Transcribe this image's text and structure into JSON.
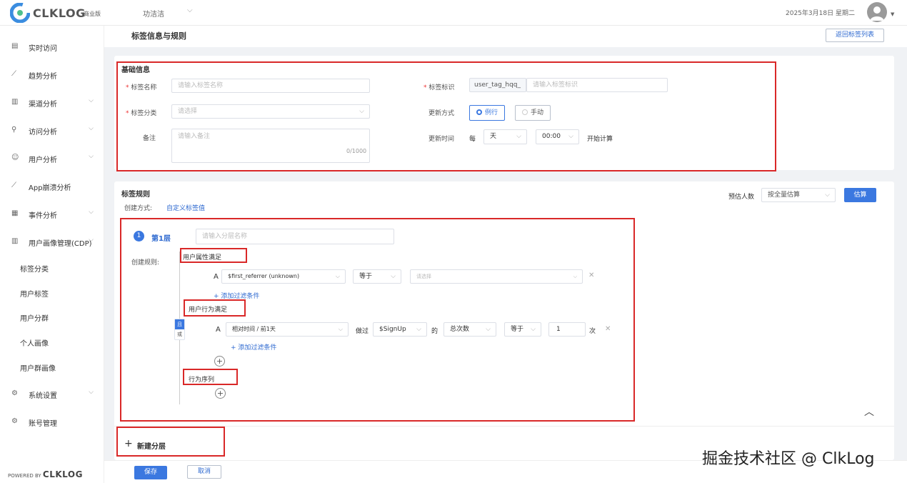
{
  "header": {
    "brand": "CLKLOG",
    "edition": "商业版",
    "project": "功洁洁",
    "date": "2025年3月18日 星期二"
  },
  "sidebar": {
    "items": [
      {
        "label": "实时访问",
        "icon": "realtime-icon",
        "has_chevron": false
      },
      {
        "label": "趋势分析",
        "icon": "trend-icon",
        "has_chevron": false
      },
      {
        "label": "渠道分析",
        "icon": "channel-icon",
        "has_chevron": true
      },
      {
        "label": "访问分析",
        "icon": "visit-icon",
        "has_chevron": true
      },
      {
        "label": "用户分析",
        "icon": "user-icon",
        "has_chevron": true
      },
      {
        "label": "App崩溃分析",
        "icon": "crash-icon",
        "has_chevron": false
      },
      {
        "label": "事件分析",
        "icon": "event-icon",
        "has_chevron": true
      },
      {
        "label": "用户画像管理(CDP)",
        "icon": "cdp-icon",
        "has_chevron": true
      }
    ],
    "sub_items": [
      "标签分类",
      "用户标签",
      "用户分群",
      "个人画像",
      "用户群画像"
    ],
    "bottom_items": [
      {
        "label": "系统设置",
        "icon": "gear-icon",
        "has_chevron": true
      },
      {
        "label": "账号管理",
        "icon": "account-icon",
        "has_chevron": false
      }
    ],
    "powered_by": "POWERED BY",
    "powered_brand": "CLKLOG"
  },
  "page": {
    "title": "标签信息与规则",
    "back_button": "返回标签列表"
  },
  "basic": {
    "section_title": "基础信息",
    "name_label": "标签名称",
    "name_placeholder": "请输入标签名称",
    "id_label": "标签标识",
    "id_prefix": "user_tag_hqq_",
    "id_placeholder": "请输入标签标识",
    "category_label": "标签分类",
    "category_placeholder": "请选择",
    "update_mode_label": "更新方式",
    "update_mode_options": [
      "例行",
      "手动"
    ],
    "note_label": "备注",
    "note_placeholder": "请输入备注",
    "note_counter": "0/1000",
    "update_time_label": "更新时间",
    "every": "每",
    "period": "天",
    "time": "00:00",
    "start_calc": "开始计算"
  },
  "rules": {
    "section_title": "标签规则",
    "create_mode_label": "创建方式:",
    "create_mode_value": "自定义标签值",
    "estimate_label": "预估人数",
    "estimate_select": "按全量估算",
    "estimate_button": "估算",
    "layer_number": "1",
    "layer_title": "第1层",
    "layer_placeholder": "请输入分层名称",
    "create_rule_label": "创建规则:",
    "user_attr_title": "用户属性满足",
    "attr_letter": "A",
    "attr_field": "$first_referrer (unknown)",
    "attr_op": "等于",
    "attr_value_placeholder": "请选择",
    "add_filter": "+ 添加过滤条件",
    "user_behavior_title": "用户行为满足",
    "and_label": "且",
    "or_label": "或",
    "beh_letter": "A",
    "beh_time": "相对时间 / 前1天",
    "beh_did": "做过",
    "beh_event": "$SignUp",
    "beh_of": "的",
    "beh_metric": "总次数",
    "beh_op": "等于",
    "beh_value": "1",
    "beh_unit": "次",
    "add_filter2": "+ 添加过滤条件",
    "sequence_title": "行为序列",
    "collapse_icon": "chevron-up-icon"
  },
  "new_layer": {
    "label": "新建分层"
  },
  "footer": {
    "save": "保存",
    "cancel": "取消"
  },
  "watermark": "掘金技术社区 @ ClkLog",
  "colors": {
    "primary": "#3b78e0",
    "highlight_box": "#d92828",
    "required": "#e33333"
  }
}
